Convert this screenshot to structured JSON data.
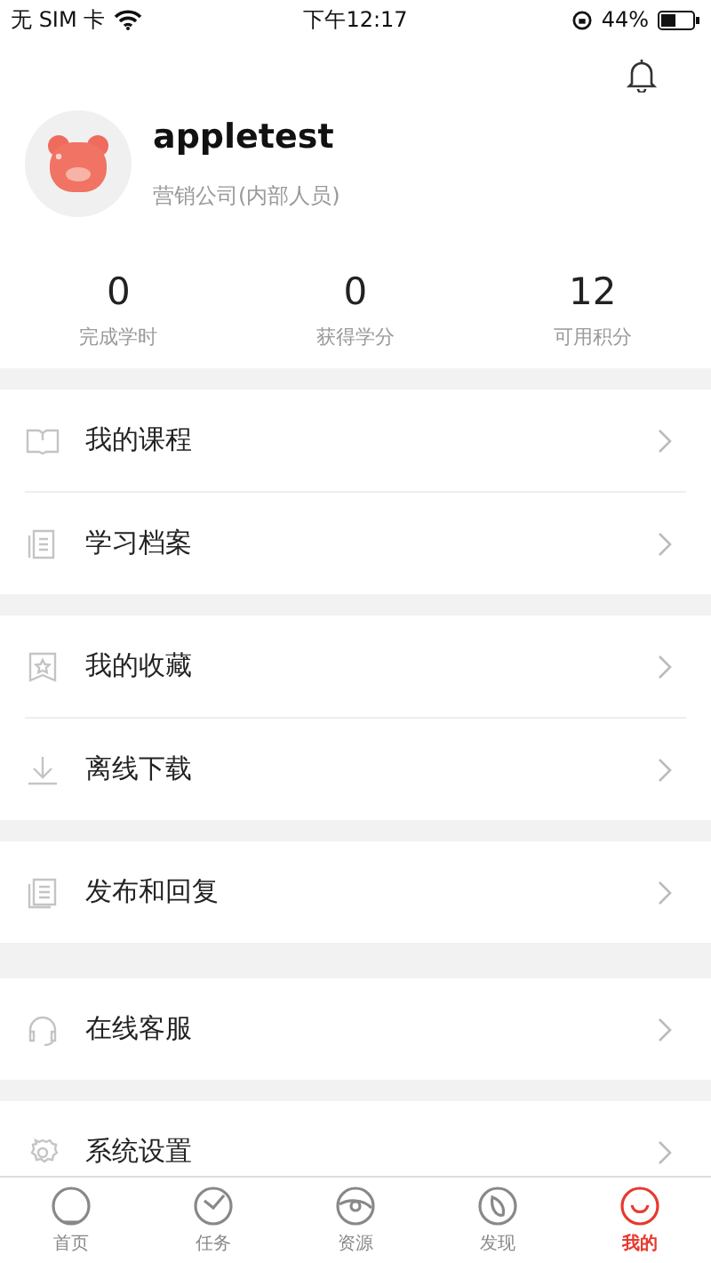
{
  "status_bar": {
    "carrier": "无 SIM 卡",
    "time": "下午12:17",
    "battery": "44%"
  },
  "profile": {
    "name": "appletest",
    "org": "营销公司(内部人员)"
  },
  "stats": [
    {
      "value": "0",
      "label": "完成学时"
    },
    {
      "value": "0",
      "label": "获得学分"
    },
    {
      "value": "12",
      "label": "可用积分"
    }
  ],
  "menu_groups": [
    [
      {
        "label": "我的课程"
      },
      {
        "label": "学习档案"
      }
    ],
    [
      {
        "label": "我的收藏"
      },
      {
        "label": "离线下载"
      }
    ],
    [
      {
        "label": "发布和回复"
      }
    ],
    [
      {
        "label": "在线客服"
      }
    ],
    [
      {
        "label": "系统设置"
      }
    ]
  ],
  "tabs": [
    {
      "label": "首页",
      "selected": false
    },
    {
      "label": "任务",
      "selected": false
    },
    {
      "label": "资源",
      "selected": false
    },
    {
      "label": "发现",
      "selected": false
    },
    {
      "label": "我的",
      "selected": true
    }
  ]
}
